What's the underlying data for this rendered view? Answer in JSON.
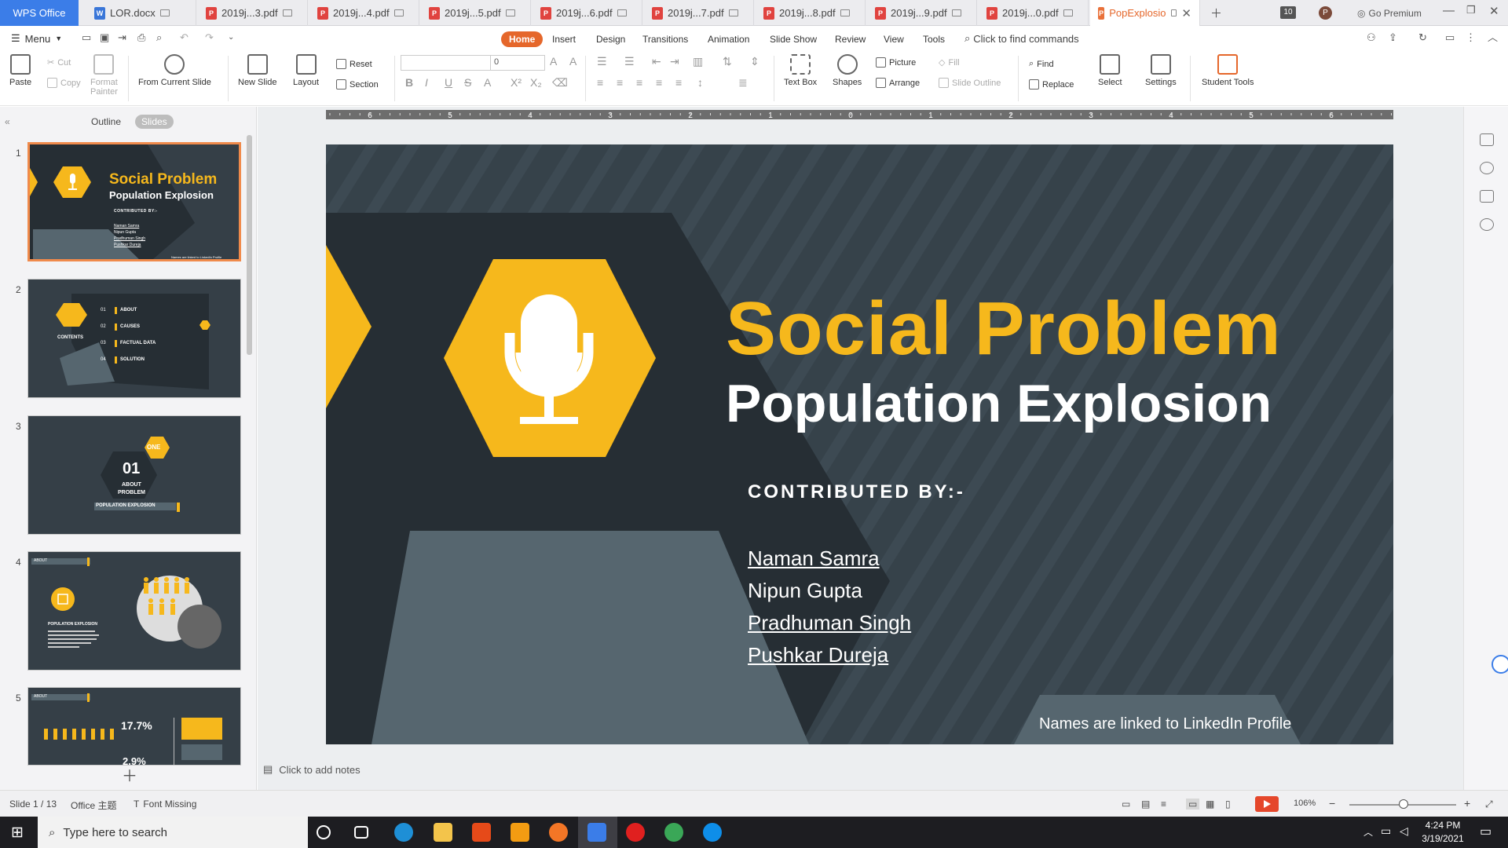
{
  "tabs": {
    "home": "WPS Office",
    "items": [
      {
        "label": "LOR.docx",
        "kind": "doc"
      },
      {
        "label": "2019j...3.pdf",
        "kind": "pdf"
      },
      {
        "label": "2019j...4.pdf",
        "kind": "pdf"
      },
      {
        "label": "2019j...5.pdf",
        "kind": "pdf"
      },
      {
        "label": "2019j...6.pdf",
        "kind": "pdf"
      },
      {
        "label": "2019j...7.pdf",
        "kind": "pdf"
      },
      {
        "label": "2019j...8.pdf",
        "kind": "pdf"
      },
      {
        "label": "2019j...9.pdf",
        "kind": "pdf"
      },
      {
        "label": "2019j...0.pdf",
        "kind": "pdf"
      },
      {
        "label": "PopExplosio",
        "kind": "ppt",
        "active": true
      }
    ],
    "count_badge": "10",
    "avatar_letter": "P",
    "go_premium": "Go Premium"
  },
  "menu": {
    "menu_label": "Menu",
    "tabs": [
      "Home",
      "Insert",
      "Design",
      "Transitions",
      "Animation",
      "Slide Show",
      "Review",
      "View",
      "Tools"
    ],
    "active_tab": "Home",
    "find_placeholder": "Click to find commands"
  },
  "ribbon": {
    "paste": "Paste",
    "cut": "Cut",
    "copy": "Copy",
    "format_painter_1": "Format",
    "format_painter_2": "Painter",
    "from_current_slide": "From Current Slide",
    "new_slide": "New Slide",
    "layout": "Layout",
    "reset": "Reset",
    "section": "Section",
    "font_size": "0",
    "text_box": "Text Box",
    "shapes": "Shapes",
    "picture": "Picture",
    "arrange": "Arrange",
    "fill": "Fill",
    "slide_outline": "Slide Outline",
    "find": "Find",
    "replace": "Replace",
    "select": "Select",
    "settings": "Settings",
    "student_tools": "Student Tools"
  },
  "panel": {
    "outline_tab": "Outline",
    "slides_tab": "Slides",
    "slide_numbers": [
      "1",
      "2",
      "3",
      "4",
      "5"
    ],
    "thumb1": {
      "title": "Social Problem",
      "subtitle": "Population Explosion",
      "contributed": "CONTRIBUTED BY:-",
      "names": [
        "Naman Samra",
        "Nipun Gupta",
        "Pradhuman Singh",
        "Pushkar Dureja"
      ],
      "footer": "Names are linked to LinkedIn Profile"
    },
    "thumb2": {
      "badge": "CONTENTS",
      "items": [
        {
          "num": "01",
          "label": "ABOUT"
        },
        {
          "num": "02",
          "label": "CAUSES"
        },
        {
          "num": "03",
          "label": "FACTUAL DATA"
        },
        {
          "num": "04",
          "label": "SOLUTION"
        }
      ]
    },
    "thumb3": {
      "badge": "ONE",
      "num": "01",
      "line1": "ABOUT",
      "line2": "PROBLEM",
      "line3": "POPULATION EXPLOSION"
    },
    "thumb4": {
      "tag": "ABOUT",
      "heading": "POPULATION EXPLOSION"
    },
    "thumb5": {
      "tag": "ABOUT",
      "stat1": "17.7%",
      "stat2": "2.9%"
    }
  },
  "slide": {
    "title": "Social Problem",
    "subtitle": "Population Explosion",
    "contributed": "CONTRIBUTED BY:-",
    "names": [
      "Naman Samra",
      "Nipun Gupta",
      "Pradhuman Singh",
      "Pushkar Dureja"
    ],
    "footer": "Names are linked to LinkedIn Profile",
    "colors": {
      "background": "#36424a",
      "accent": "#f6b81c",
      "dark": "#262e34",
      "slate": "#56666f"
    }
  },
  "ruler_labels": [
    "6",
    "5",
    "4",
    "3",
    "2",
    "1",
    "0",
    "1",
    "2",
    "3",
    "4",
    "5",
    "6"
  ],
  "notes_placeholder": "Click to add notes",
  "status": {
    "slide_counter": "Slide 1 / 13",
    "theme": "Office 主题",
    "font_missing": "Font Missing",
    "zoom": "106%"
  },
  "taskbar": {
    "search_placeholder": "Type here to search",
    "time": "4:24 PM",
    "date": "3/19/2021"
  }
}
